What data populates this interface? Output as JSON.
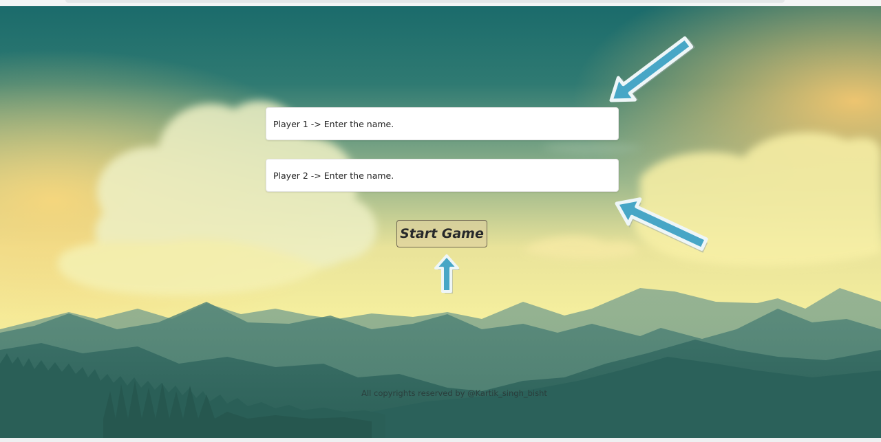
{
  "form": {
    "player1_placeholder": "Player 1 -> Enter the name.",
    "player1_value": "",
    "player2_placeholder": "Player 2 -> Enter the name.",
    "player2_value": "",
    "start_label": "Start Game"
  },
  "footer": {
    "copyright": "All copyrights reserved by @Kartik_singh_bisht"
  },
  "annotations": {
    "arrow_color": "#47a6c6",
    "arrow_outline": "#eef6f8",
    "arrows": [
      "arrow-pointing-player1-input",
      "arrow-pointing-player2-input",
      "arrow-pointing-start-button"
    ]
  },
  "colors": {
    "sky_top": "#1b6d6c",
    "sky_glow": "#f4ea9a",
    "mountain_far": "#5f8f83",
    "mountain_near": "#2f675f",
    "forest": "#2a5f57",
    "button_border": "#6d6451"
  }
}
